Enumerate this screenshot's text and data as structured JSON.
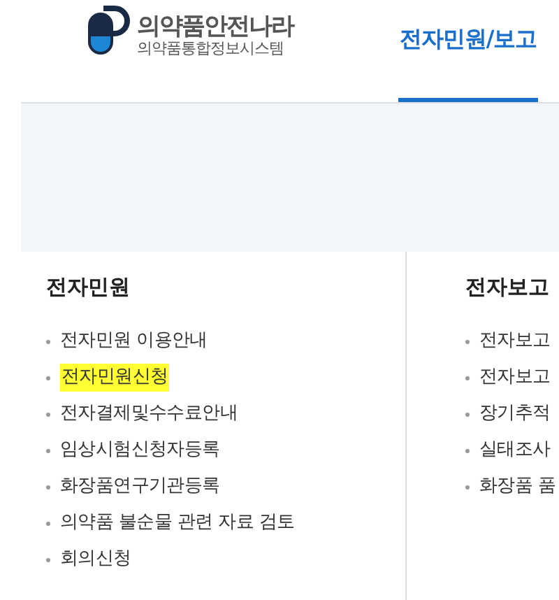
{
  "logo": {
    "name": "의약품안전나라",
    "subtitle": "의약품통합정보시스템"
  },
  "nav": {
    "tabs": [
      {
        "label": "전자민원/보고",
        "selected": true
      }
    ]
  },
  "menus": [
    {
      "title": "전자민원",
      "items": [
        {
          "label": "전자민원 이용안내",
          "highlighted": false
        },
        {
          "label": "전자민원신청",
          "highlighted": true
        },
        {
          "label": "전자결제및수수료안내",
          "highlighted": false
        },
        {
          "label": "임상시험신청자등록",
          "highlighted": false
        },
        {
          "label": "화장품연구기관등록",
          "highlighted": false
        },
        {
          "label": "의약품 불순물 관련 자료 검토",
          "highlighted": false
        },
        {
          "label": "회의신청",
          "highlighted": false
        }
      ]
    },
    {
      "title": "전자보고",
      "items": [
        {
          "label": "전자보고",
          "highlighted": false
        },
        {
          "label": "전자보고",
          "highlighted": false
        },
        {
          "label": "장기추적",
          "highlighted": false
        },
        {
          "label": "실태조사",
          "highlighted": false
        },
        {
          "label": "화장품 품",
          "highlighted": false
        }
      ]
    }
  ]
}
